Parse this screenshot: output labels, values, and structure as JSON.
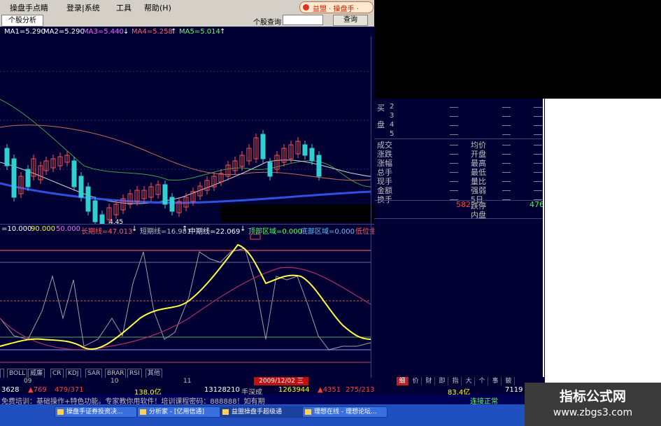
{
  "menu": {
    "items": [
      "操盘手点睛",
      "登录|系统",
      "工具",
      "帮助(H)"
    ],
    "query_label": "个股查询",
    "query_button": "查询",
    "brand_text": "益盟 · 操盘手 ·"
  },
  "toolbar": {
    "tab_label": "个股分析"
  },
  "ma_legend": [
    {
      "text": "MA1=5.290",
      "color": "#ffffff"
    },
    {
      "text": "MA2=5.290",
      "color": "#ffffff"
    },
    {
      "text": "MA3=5.440",
      "color": "#ff60ff"
    },
    {
      "text": "↓",
      "color": "#ffffff"
    },
    {
      "text": "MA4=5.258",
      "color": "#ff6060"
    },
    {
      "text": "↑",
      "color": "#ffffff"
    },
    {
      "text": "MA5=5.014",
      "color": "#60ff60"
    },
    {
      "text": "↑",
      "color": "#ffffff"
    }
  ],
  "price_low_label": "4.45",
  "indicator_legend": [
    {
      "text": "=10.000",
      "color": "#ffffff"
    },
    {
      "text": "90.000",
      "color": "#ffff00"
    },
    {
      "text": "50.000",
      "color": "#ff60ff"
    },
    {
      "text": "长期线=47.013",
      "color": "#ff6060"
    },
    {
      "text": "↓",
      "color": "#ffffff"
    },
    {
      "text": "短期线=16.981",
      "color": "#c0c0c0"
    },
    {
      "text": "↑",
      "color": "#ffffff"
    },
    {
      "text": "中期线=22.069",
      "color": "#ffffff"
    },
    {
      "text": "↓",
      "color": "#ffffff"
    },
    {
      "text": "顶部区域=0.000",
      "color": "#60ff60"
    },
    {
      "text": "底部区域=0.000",
      "color": "#60c0ff"
    },
    {
      "text": "低位金",
      "color": "#ff6060"
    }
  ],
  "quote": {
    "sell_label_1": "买",
    "sell_label_2": "盘",
    "levels": [
      "2",
      "3",
      "4",
      "5"
    ],
    "left_labels": [
      "成交",
      "涨跌",
      "涨幅",
      "总手",
      "现手",
      "金额",
      "换手"
    ],
    "right_labels": [
      "均价",
      "开盘",
      "最高",
      "最低",
      "量比",
      "强弱",
      "5日"
    ],
    "up_value": "582",
    "down_label": "跌停",
    "down_value": "476",
    "inner_label": "内盘"
  },
  "indicator_tabs": [
    "",
    "BOLL",
    "威廉",
    "CR",
    "KDJ",
    "SAR",
    "BRAR",
    "RSI",
    "其他"
  ],
  "x_ticks": [
    "09",
    "10",
    "11"
  ],
  "date_box": "2009/12/02 三",
  "status": [
    {
      "text": "3628",
      "color": "#ffffff"
    },
    {
      "text": "▲769",
      "color": "#ff4040"
    },
    {
      "text": "479/371",
      "color": "#ff4040"
    },
    {
      "text": "138.0亿",
      "color": "#ffff00"
    },
    {
      "text": "13128210",
      "color": "#ffffff"
    },
    {
      "text": "手深成",
      "color": "#c0c0c0"
    },
    {
      "text": "1263944",
      "color": "#ffff00"
    },
    {
      "text": "▲4351",
      "color": "#ff4040"
    },
    {
      "text": "275/213",
      "color": "#ff4040"
    },
    {
      "text": "83.4亿",
      "color": "#ffff00"
    },
    {
      "text": "7119",
      "color": "#ffffff"
    }
  ],
  "ticker": {
    "text": "免费培训：基础操作+特色功能。专家教你用软件！培训课程密码：888888！如有期",
    "right": "连接正常"
  },
  "taskbar": [
    "操盘手证券投资决...",
    "分析家 - [亿用信通]",
    "益盟操盘手超级通",
    "理想在线 - 理想论坛..."
  ],
  "right_tabs": [
    "细",
    "价",
    "财",
    "即",
    "指",
    "大",
    "个",
    "事",
    "鈹"
  ],
  "watermark": {
    "title": "指标公式网",
    "url": "www.zbgs3.com"
  }
}
